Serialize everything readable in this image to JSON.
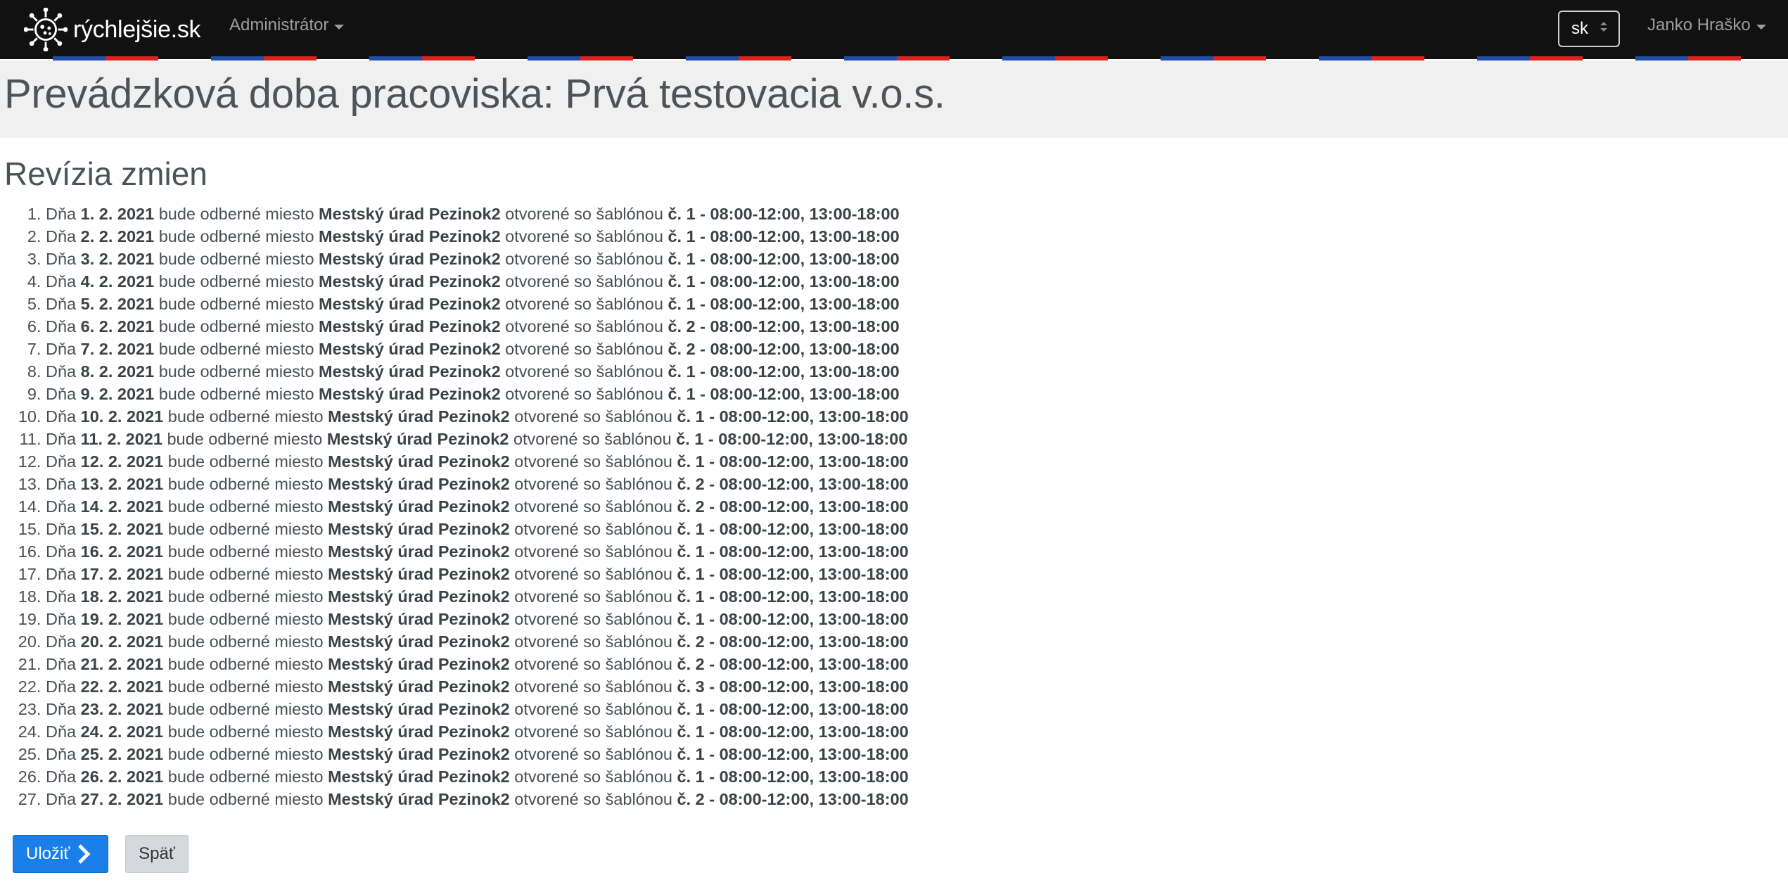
{
  "navbar": {
    "brand_name": "rýchlejšie.sk",
    "logo_icon": "virus-logo-icon",
    "menu_admin": "Administrátor",
    "language": "sk",
    "user_name": "Janko Hraško"
  },
  "page": {
    "title": "Prevádzková doba pracoviska: Prvá testovacia v.o.s."
  },
  "revisions": {
    "heading": "Revízia zmien",
    "items": [
      {
        "prefix": "Dňa ",
        "date": "1. 2. 2021",
        "mid1": " bude odberné miesto ",
        "place": "Mestský úrad Pezinok2",
        "mid2": " otvorené so šablónou ",
        "template": "č. 1",
        "sep": " - ",
        "hours": "08:00-12:00, 13:00-18:00"
      },
      {
        "prefix": "Dňa ",
        "date": "2. 2. 2021",
        "mid1": " bude odberné miesto ",
        "place": "Mestský úrad Pezinok2",
        "mid2": " otvorené so šablónou ",
        "template": "č. 1",
        "sep": " - ",
        "hours": "08:00-12:00, 13:00-18:00"
      },
      {
        "prefix": "Dňa ",
        "date": "3. 2. 2021",
        "mid1": " bude odberné miesto ",
        "place": "Mestský úrad Pezinok2",
        "mid2": " otvorené so šablónou ",
        "template": "č. 1",
        "sep": " - ",
        "hours": "08:00-12:00, 13:00-18:00"
      },
      {
        "prefix": "Dňa ",
        "date": "4. 2. 2021",
        "mid1": " bude odberné miesto ",
        "place": "Mestský úrad Pezinok2",
        "mid2": " otvorené so šablónou ",
        "template": "č. 1",
        "sep": " - ",
        "hours": "08:00-12:00, 13:00-18:00"
      },
      {
        "prefix": "Dňa ",
        "date": "5. 2. 2021",
        "mid1": " bude odberné miesto ",
        "place": "Mestský úrad Pezinok2",
        "mid2": " otvorené so šablónou ",
        "template": "č. 1",
        "sep": " - ",
        "hours": "08:00-12:00, 13:00-18:00"
      },
      {
        "prefix": "Dňa ",
        "date": "6. 2. 2021",
        "mid1": " bude odberné miesto ",
        "place": "Mestský úrad Pezinok2",
        "mid2": " otvorené so šablónou ",
        "template": "č. 2",
        "sep": " - ",
        "hours": "08:00-12:00, 13:00-18:00"
      },
      {
        "prefix": "Dňa ",
        "date": "7. 2. 2021",
        "mid1": " bude odberné miesto ",
        "place": "Mestský úrad Pezinok2",
        "mid2": " otvorené so šablónou ",
        "template": "č. 2",
        "sep": " - ",
        "hours": "08:00-12:00, 13:00-18:00"
      },
      {
        "prefix": "Dňa ",
        "date": "8. 2. 2021",
        "mid1": " bude odberné miesto ",
        "place": "Mestský úrad Pezinok2",
        "mid2": " otvorené so šablónou ",
        "template": "č. 1",
        "sep": " - ",
        "hours": "08:00-12:00, 13:00-18:00"
      },
      {
        "prefix": "Dňa ",
        "date": "9. 2. 2021",
        "mid1": " bude odberné miesto ",
        "place": "Mestský úrad Pezinok2",
        "mid2": " otvorené so šablónou ",
        "template": "č. 1",
        "sep": " - ",
        "hours": "08:00-12:00, 13:00-18:00"
      },
      {
        "prefix": "Dňa ",
        "date": "10. 2. 2021",
        "mid1": " bude odberné miesto ",
        "place": "Mestský úrad Pezinok2",
        "mid2": " otvorené so šablónou ",
        "template": "č. 1",
        "sep": " - ",
        "hours": "08:00-12:00, 13:00-18:00"
      },
      {
        "prefix": "Dňa ",
        "date": "11. 2. 2021",
        "mid1": " bude odberné miesto ",
        "place": "Mestský úrad Pezinok2",
        "mid2": " otvorené so šablónou ",
        "template": "č. 1",
        "sep": " - ",
        "hours": "08:00-12:00, 13:00-18:00"
      },
      {
        "prefix": "Dňa ",
        "date": "12. 2. 2021",
        "mid1": " bude odberné miesto ",
        "place": "Mestský úrad Pezinok2",
        "mid2": " otvorené so šablónou ",
        "template": "č. 1",
        "sep": " - ",
        "hours": "08:00-12:00, 13:00-18:00"
      },
      {
        "prefix": "Dňa ",
        "date": "13. 2. 2021",
        "mid1": " bude odberné miesto ",
        "place": "Mestský úrad Pezinok2",
        "mid2": " otvorené so šablónou ",
        "template": "č. 2",
        "sep": " - ",
        "hours": "08:00-12:00, 13:00-18:00"
      },
      {
        "prefix": "Dňa ",
        "date": "14. 2. 2021",
        "mid1": " bude odberné miesto ",
        "place": "Mestský úrad Pezinok2",
        "mid2": " otvorené so šablónou ",
        "template": "č. 2",
        "sep": " - ",
        "hours": "08:00-12:00, 13:00-18:00"
      },
      {
        "prefix": "Dňa ",
        "date": "15. 2. 2021",
        "mid1": " bude odberné miesto ",
        "place": "Mestský úrad Pezinok2",
        "mid2": " otvorené so šablónou ",
        "template": "č. 1",
        "sep": " - ",
        "hours": "08:00-12:00, 13:00-18:00"
      },
      {
        "prefix": "Dňa ",
        "date": "16. 2. 2021",
        "mid1": " bude odberné miesto ",
        "place": "Mestský úrad Pezinok2",
        "mid2": " otvorené so šablónou ",
        "template": "č. 1",
        "sep": " - ",
        "hours": "08:00-12:00, 13:00-18:00"
      },
      {
        "prefix": "Dňa ",
        "date": "17. 2. 2021",
        "mid1": " bude odberné miesto ",
        "place": "Mestský úrad Pezinok2",
        "mid2": " otvorené so šablónou ",
        "template": "č. 1",
        "sep": " - ",
        "hours": "08:00-12:00, 13:00-18:00"
      },
      {
        "prefix": "Dňa ",
        "date": "18. 2. 2021",
        "mid1": " bude odberné miesto ",
        "place": "Mestský úrad Pezinok2",
        "mid2": " otvorené so šablónou ",
        "template": "č. 1",
        "sep": " - ",
        "hours": "08:00-12:00, 13:00-18:00"
      },
      {
        "prefix": "Dňa ",
        "date": "19. 2. 2021",
        "mid1": " bude odberné miesto ",
        "place": "Mestský úrad Pezinok2",
        "mid2": " otvorené so šablónou ",
        "template": "č. 1",
        "sep": " - ",
        "hours": "08:00-12:00, 13:00-18:00"
      },
      {
        "prefix": "Dňa ",
        "date": "20. 2. 2021",
        "mid1": " bude odberné miesto ",
        "place": "Mestský úrad Pezinok2",
        "mid2": " otvorené so šablónou ",
        "template": "č. 2",
        "sep": " - ",
        "hours": "08:00-12:00, 13:00-18:00"
      },
      {
        "prefix": "Dňa ",
        "date": "21. 2. 2021",
        "mid1": " bude odberné miesto ",
        "place": "Mestský úrad Pezinok2",
        "mid2": " otvorené so šablónou ",
        "template": "č. 2",
        "sep": " - ",
        "hours": "08:00-12:00, 13:00-18:00"
      },
      {
        "prefix": "Dňa ",
        "date": "22. 2. 2021",
        "mid1": " bude odberné miesto ",
        "place": "Mestský úrad Pezinok2",
        "mid2": " otvorené so šablónou ",
        "template": "č. 3",
        "sep": " - ",
        "hours": "08:00-12:00, 13:00-18:00"
      },
      {
        "prefix": "Dňa ",
        "date": "23. 2. 2021",
        "mid1": " bude odberné miesto ",
        "place": "Mestský úrad Pezinok2",
        "mid2": " otvorené so šablónou ",
        "template": "č. 1",
        "sep": " - ",
        "hours": "08:00-12:00, 13:00-18:00"
      },
      {
        "prefix": "Dňa ",
        "date": "24. 2. 2021",
        "mid1": " bude odberné miesto ",
        "place": "Mestský úrad Pezinok2",
        "mid2": " otvorené so šablónou ",
        "template": "č. 1",
        "sep": " - ",
        "hours": "08:00-12:00, 13:00-18:00"
      },
      {
        "prefix": "Dňa ",
        "date": "25. 2. 2021",
        "mid1": " bude odberné miesto ",
        "place": "Mestský úrad Pezinok2",
        "mid2": " otvorené so šablónou ",
        "template": "č. 1",
        "sep": " - ",
        "hours": "08:00-12:00, 13:00-18:00"
      },
      {
        "prefix": "Dňa ",
        "date": "26. 2. 2021",
        "mid1": " bude odberné miesto ",
        "place": "Mestský úrad Pezinok2",
        "mid2": " otvorené so šablónou ",
        "template": "č. 1",
        "sep": " - ",
        "hours": "08:00-12:00, 13:00-18:00"
      },
      {
        "prefix": "Dňa ",
        "date": "27. 2. 2021",
        "mid1": " bude odberné miesto ",
        "place": "Mestský úrad Pezinok2",
        "mid2": " otvorené so šablónou ",
        "template": "č. 2",
        "sep": " - ",
        "hours": "08:00-12:00, 13:00-18:00"
      }
    ]
  },
  "actions": {
    "save_label": "Uložiť",
    "save_icon": "chevron-right-icon",
    "back_label": "Späť"
  },
  "colors": {
    "navbar_bg": "#111111",
    "header_band_bg": "#f0f0f0",
    "primary_button": "#1a7fe8",
    "secondary_button": "#d5d8dc",
    "flag_blue": "#1f4ea8",
    "flag_red": "#d7261e"
  }
}
